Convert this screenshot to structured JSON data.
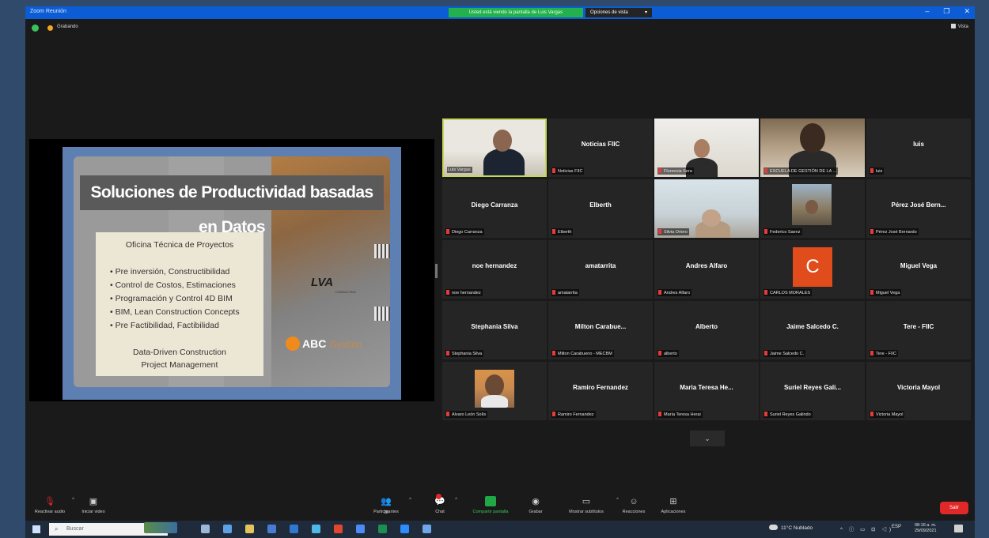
{
  "window": {
    "title": "Zoom Reunión",
    "share_banner": "Usted está viendo la pantalla de Luis Vargas",
    "view_options": "Opciones de vista",
    "recording": "Grabando",
    "view_button": "Vista"
  },
  "slide": {
    "title": "Soluciones de Productividad basadas en Datos",
    "box_heading": "Oficina Técnica de Proyectos",
    "items": [
      "• Pre inversión, Constructibilidad",
      "• Control de Costos, Estimaciones",
      "• Programación y Control 4D BIM",
      "• BIM, Lean Construction Concepts",
      "• Pre Factibilidad, Factibilidad"
    ],
    "footer_line1": "Data-Driven Construction",
    "footer_line2": "Project Management",
    "lva": "LVA",
    "lva_sub": "CONSULTING",
    "abc": "ABC",
    "abc_suffix": "Gestión"
  },
  "gallery": [
    {
      "name": "",
      "label": "Luis Vargas"
    },
    {
      "name": "Noticias FIIC",
      "label": "Noticias FIIC"
    },
    {
      "name": "",
      "label": "Florencia Sera"
    },
    {
      "name": "",
      "label": "ESCUELA DE GESTIÓN DE LA ..."
    },
    {
      "name": "luis",
      "label": "luis"
    },
    {
      "name": "Diego Carranza",
      "label": "Diego Carranza"
    },
    {
      "name": "Elberth",
      "label": "Elberth"
    },
    {
      "name": "",
      "label": "Silvia Oriero"
    },
    {
      "name": "",
      "label": "Federico Saenz"
    },
    {
      "name": "Pérez José Bern...",
      "label": "Pérez José Bernardo"
    },
    {
      "name": "noe hernandez",
      "label": "noe hernandez"
    },
    {
      "name": "amatarrita",
      "label": "amatarrita"
    },
    {
      "name": "Andres Alfaro",
      "label": "Andres Alfaro"
    },
    {
      "name": "C",
      "label": "CARLOS MORALES"
    },
    {
      "name": "Miguel Vega",
      "label": "Miguel Vega"
    },
    {
      "name": "Stephania Silva",
      "label": "Stephania Silva"
    },
    {
      "name": "Milton Carabue...",
      "label": "Milton Carabueno - MECBM"
    },
    {
      "name": "Alberto",
      "label": "alberto"
    },
    {
      "name": "Jaime Salcedo C.",
      "label": "Jaime Salcedo C."
    },
    {
      "name": "Tere - FIIC",
      "label": "Tere - FIIC"
    },
    {
      "name": "",
      "label": "Alvaro León Solís"
    },
    {
      "name": "Ramiro Fernandez",
      "label": "Ramiro Fernandez"
    },
    {
      "name": "Maria Teresa He...",
      "label": "María Teresa Herai"
    },
    {
      "name": "Suriel Reyes Gali...",
      "label": "Suriel Reyes Galindo"
    },
    {
      "name": "Victoria Mayol",
      "label": "Victoria Mayol"
    }
  ],
  "toolbar": {
    "unmute": "Reactivar audio",
    "start_video": "Iniciar video",
    "participants": "Participantes",
    "participants_count": "28",
    "chat": "Chat",
    "share_screen": "Compartir pantalla",
    "record": "Grabar",
    "captions": "Mostrar subtítulos",
    "reactions": "Reacciones",
    "apps": "Aplicaciones",
    "end": "Salir"
  },
  "taskbar": {
    "search_placeholder": "Buscar",
    "weather": "11°C  Nublado",
    "tray": "^ ⓘ ▭ ⊡ ◁)",
    "lang": "ESP",
    "time": "08:16 a. m.",
    "date": "29/09/2021"
  },
  "colors": {
    "window_title_bar": "#0b5cd5",
    "share_banner": "#22b14c",
    "active_speaker": "#c5d65a",
    "end_button": "#e02828",
    "avatar": "#e04c1b"
  }
}
